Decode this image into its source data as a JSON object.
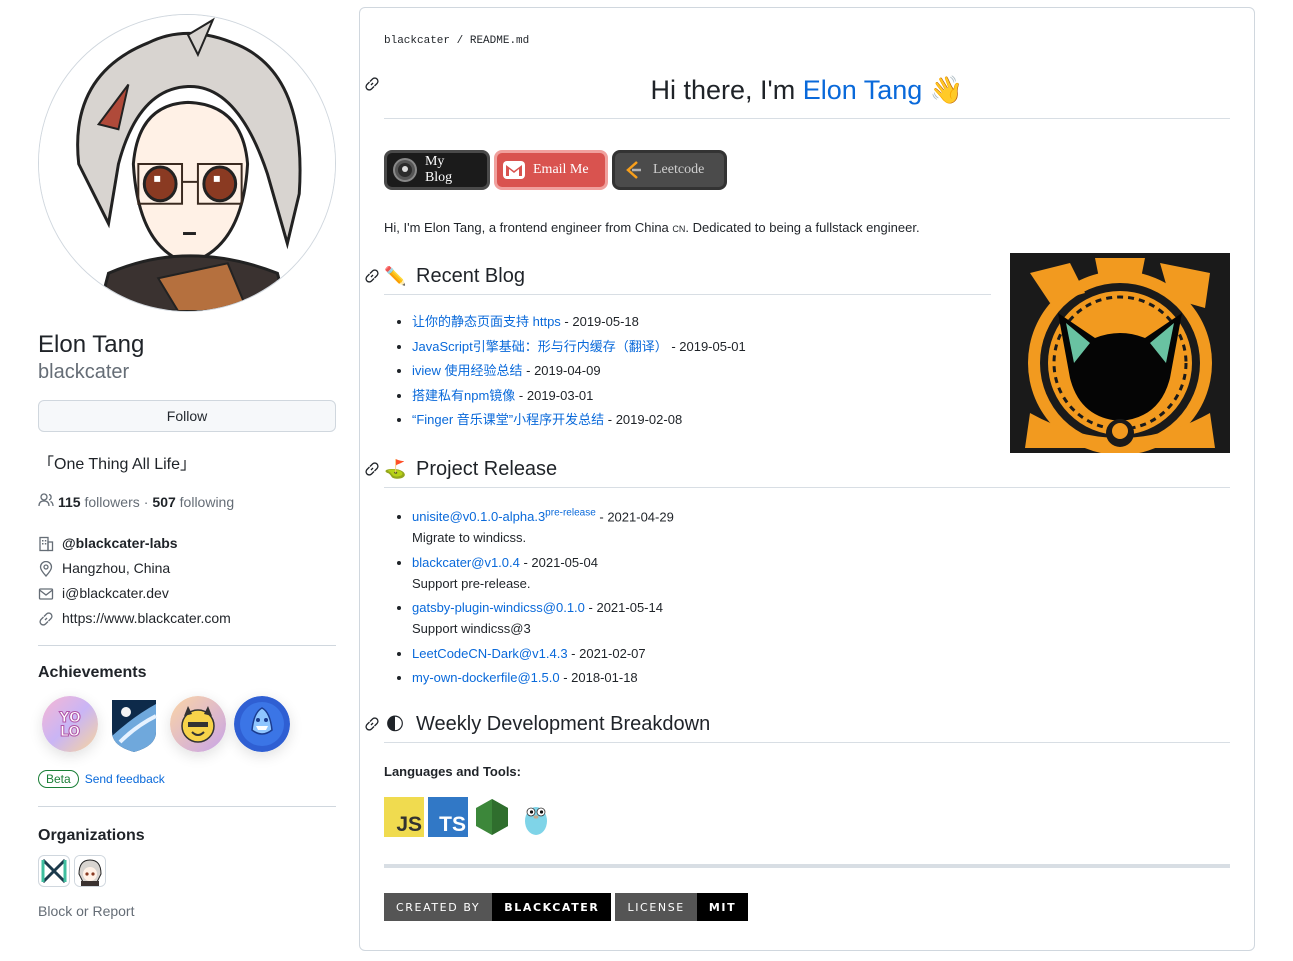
{
  "profile": {
    "name": "Elon Tang",
    "login": "blackcater",
    "follow_label": "Follow",
    "bio": "「One Thing All Life」",
    "followers_count": "115",
    "followers_label": "followers",
    "separator": "·",
    "following_count": "507",
    "following_label": "following",
    "details": {
      "org": "@blackcater-labs",
      "location": "Hangzhou, China",
      "email": "i@blackcater.dev",
      "website": "https://www.blackcater.com"
    }
  },
  "achievements": {
    "title": "Achievements",
    "badges": [
      "yolo",
      "starstruck",
      "quickdraw",
      "pull-shark"
    ],
    "beta_label": "Beta",
    "feedback_label": "Send feedback"
  },
  "organizations": {
    "title": "Organizations",
    "block_label": "Block or Report"
  },
  "readme": {
    "breadcrumb_user": "blackcater",
    "breadcrumb_sep": "/",
    "breadcrumb_file": "README.md",
    "heading_prefix": "Hi there, I'm ",
    "heading_name": "Elon Tang",
    "heading_emoji": "👋",
    "buttons": {
      "blog": "My Blog",
      "email": "Email Me",
      "leetcode": "Leetcode"
    },
    "intro_prefix": "Hi, I'm Elon Tang, a frontend engineer from China ",
    "intro_flag": "CN",
    "intro_suffix": ". Dedicated to being a fullstack engineer.",
    "recent_blog": {
      "title": "Recent Blog",
      "emoji": "✏️",
      "items": [
        {
          "title": "让你的静态页面支持 https",
          "date": "2019-05-18"
        },
        {
          "title": "JavaScript引擎基础：形与行内缓存（翻译）",
          "date": "2019-05-01"
        },
        {
          "title": "iview 使用经验总结",
          "date": "2019-04-09"
        },
        {
          "title": "搭建私有npm镜像",
          "date": "2019-03-01"
        },
        {
          "title": "“Finger 音乐课堂”小程序开发总结",
          "date": "2019-02-08"
        }
      ]
    },
    "project_release": {
      "title": "Project Release",
      "emoji": "⛳",
      "items": [
        {
          "name": "unisite@v0.1.0-alpha.3",
          "tag": "pre-release",
          "date": "2021-04-29",
          "desc": "Migrate to windicss."
        },
        {
          "name": "blackcater@v1.0.4",
          "tag": "",
          "date": "2021-05-04",
          "desc": "Support pre-release."
        },
        {
          "name": "gatsby-plugin-windicss@0.1.0",
          "tag": "",
          "date": "2021-05-14",
          "desc": "Support windicss@3"
        },
        {
          "name": "LeetCodeCN-Dark@v1.4.3",
          "tag": "",
          "date": "2021-02-07",
          "desc": ""
        },
        {
          "name": "my-own-dockerfile@1.5.0",
          "tag": "",
          "date": "2018-01-18",
          "desc": ""
        }
      ]
    },
    "weekly": {
      "title": "Weekly Development Breakdown",
      "emoji": "🌓"
    },
    "languages_label": "Languages and Tools:",
    "tools": {
      "js": "JS",
      "ts": "TS"
    },
    "shields": {
      "created_by_label": "CREATED BY",
      "created_by_value": "BLACKCATER",
      "license_label": "LICENSE",
      "license_value": "MIT"
    }
  },
  "colors": {
    "link": "#0969da",
    "text": "#1f2328",
    "muted": "#656d76",
    "border": "#d0d7de",
    "beta_green": "#1a7f37",
    "email_red": "#d9534f",
    "js_yellow": "#f0db4f",
    "ts_blue": "#3178c6"
  }
}
